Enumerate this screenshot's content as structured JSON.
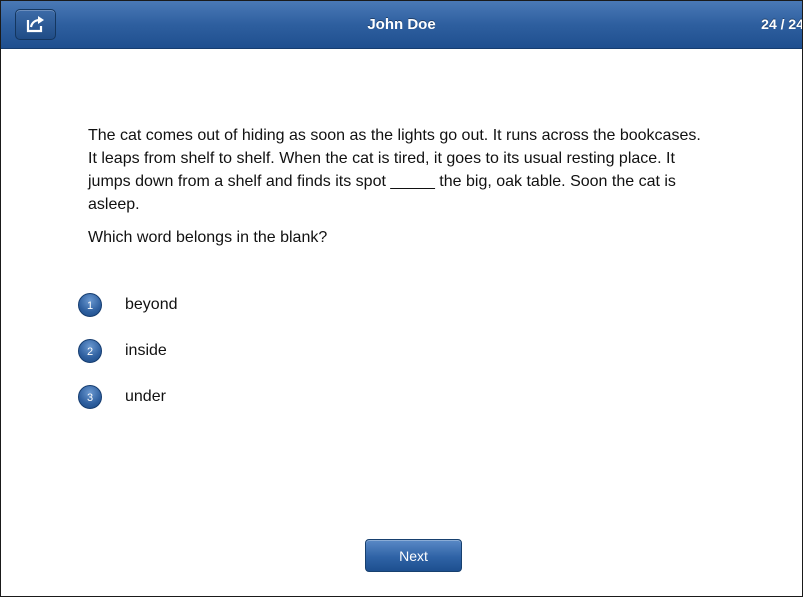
{
  "header": {
    "share_icon": "share-icon",
    "title": "John Doe",
    "progress": "24 / 24"
  },
  "passage": "The cat comes out of hiding as soon as the lights go out. It runs across the bookcases. It leaps from shelf to shelf. When the cat is tired, it goes to its usual resting place. It jumps down from a shelf and finds its spot _____ the big, oak table. Soon the cat is asleep.",
  "question": "Which word belongs in the blank?",
  "options": [
    {
      "number": "1",
      "label": "beyond"
    },
    {
      "number": "2",
      "label": "inside"
    },
    {
      "number": "3",
      "label": "under"
    }
  ],
  "footer": {
    "next_label": "Next"
  },
  "colors": {
    "accent": "#2e5f9f",
    "header_text": "#ffffff",
    "body_text": "#111111"
  }
}
